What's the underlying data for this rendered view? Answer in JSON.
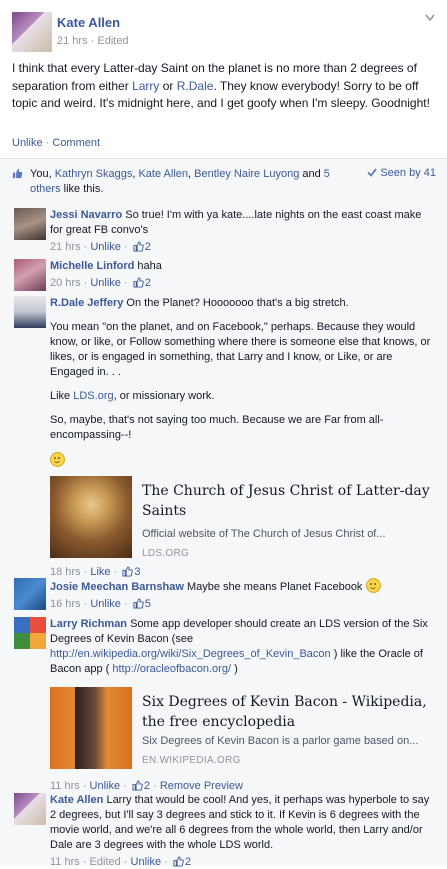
{
  "post": {
    "author": "Kate Allen",
    "time": "21 hrs",
    "edited": "Edited",
    "text_pre": "I think that every Latter-day Saint on the planet is no more than 2 degrees of separation from either ",
    "mention1": "Larry",
    "text_or": " or ",
    "mention2": "R.Dale",
    "text_post": ". They know everybody! Sorry to be off topic and weird. It's midnight here, and I get goofy when I'm sleepy. Goodnight!",
    "unlike": "Unlike",
    "comment": "Comment"
  },
  "likes": {
    "you": "You, ",
    "names": [
      "Kathryn Skaggs",
      "Kate Allen",
      "Bentley Naire Luyong"
    ],
    "and": " and ",
    "others": "5 others",
    "tail": " like this.",
    "seen": "Seen by 41"
  },
  "comments": [
    {
      "name": "Jessi Navarro",
      "text": " So true! I'm with ya kate....late nights on the east coast make for great FB convo's",
      "time": "21 hrs",
      "action": "Unlike",
      "likes": "2"
    },
    {
      "name": "Michelle Linford",
      "text": " haha",
      "time": "20 hrs",
      "action": "Unlike",
      "likes": "2"
    },
    {
      "name": "R.Dale Jeffery",
      "text": " On the Planet? Hooooooo that's a big stretch.",
      "p2": "You mean \"on the planet, and on Facebook,\" perhaps. Because they would know, or like, or Follow something where there is someone else that knows, or likes, or is engaged in something, that Larry and I know, or Like, or are Engaged in. . .",
      "p3_pre": "Like ",
      "p3_link": "LDS.org",
      "p3_post": ", or missionary work.",
      "p4": "So, maybe, that's not saying too much. Because we are Far from all-encompassing--!",
      "share": {
        "title": "The Church of Jesus Christ of Latter-day Saints",
        "desc": "Official website of The Church of Jesus Christ of...",
        "src": "LDS.ORG"
      },
      "time": "18 hrs",
      "action": "Like",
      "likes": "3"
    },
    {
      "name": "Josie Meechan Barnshaw",
      "text": " Maybe she means Planet Facebook ",
      "time": "16 hrs",
      "action": "Unlike",
      "likes": "5"
    },
    {
      "name": "Larry Richman",
      "text": " Some app developer should create an LDS version of the Six Degrees of Kevin Bacon (see ",
      "link1": "http://en.wikipedia.org/wiki/Six_Degrees_of_Kevin_Bacon",
      "mid": " ) like the Oracle of Bacon app ( ",
      "link2": "http://oracleofbacon.org/",
      "end": " )",
      "share": {
        "title": "Six Degrees of Kevin Bacon - Wikipedia, the free encyclopedia",
        "desc": "Six Degrees of Kevin Bacon is a parlor game based on...",
        "src": "EN.WIKIPEDIA.ORG"
      },
      "time": "11 hrs",
      "action": "Unlike",
      "likes": "2",
      "remove": "Remove Preview"
    },
    {
      "name": "Kate Allen",
      "text": " Larry that would be cool! And yes, it perhaps was hyperbole to say 2 degrees, but I'll say 3 degrees and stick to it. If Kevin is 6 degrees with the movie world, and we're all 6 degrees from the whole world, then Larry and/or Dale are 3 degrees with the whole LDS world.",
      "time": "11 hrs",
      "edited": "Edited",
      "action": "Unlike",
      "likes": "2"
    }
  ]
}
